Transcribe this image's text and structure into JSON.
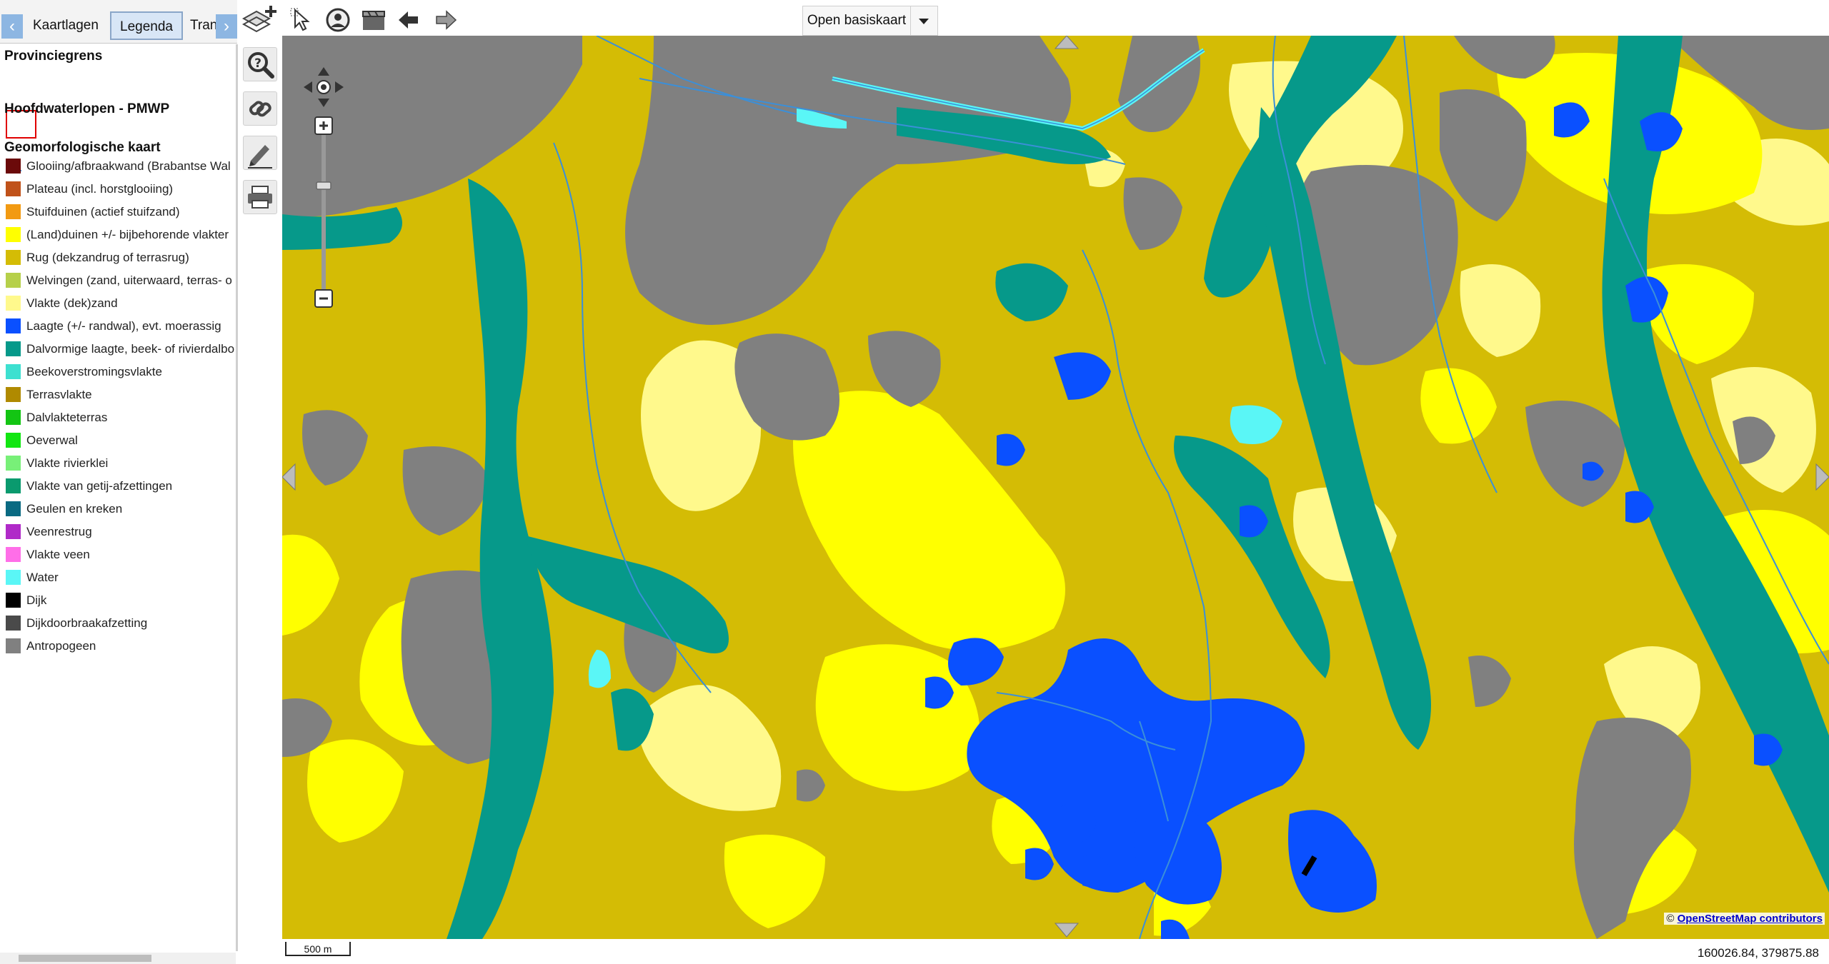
{
  "tabs": {
    "items": [
      "Kaartlagen",
      "Legenda",
      "Tran"
    ],
    "active": "Legenda"
  },
  "legend": {
    "provincie_title": "Provinciegrens",
    "water_title": "Hoofdwaterlopen - PMWP",
    "geo_title": "Geomorfologische kaart",
    "items": [
      {
        "label": "Glooiing/afbraakwand (Brabantse Wal",
        "color": "#6b0a0a"
      },
      {
        "label": "Plateau (incl. horstglooiing)",
        "color": "#c0521a"
      },
      {
        "label": "Stuifduinen (actief stuifzand)",
        "color": "#f29a12"
      },
      {
        "label": "(Land)duinen +/- bijbehorende vlakter",
        "color": "#ffff00"
      },
      {
        "label": "Rug (dekzandrug of terrasrug)",
        "color": "#d4bc05"
      },
      {
        "label": "Welvingen (zand, uiterwaard, terras- o",
        "color": "#b6d04a"
      },
      {
        "label": "Vlakte (dek)zand",
        "color": "#fff98c"
      },
      {
        "label": "Laagte (+/- randwal), evt. moerassig",
        "color": "#0a50ff"
      },
      {
        "label": "Dalvormige laagte, beek- of rivierdalbo",
        "color": "#06998a"
      },
      {
        "label": "Beekoverstromingsvlakte",
        "color": "#3de0d0"
      },
      {
        "label": "Terrasvlakte",
        "color": "#b08a00"
      },
      {
        "label": "Dalvlakteterras",
        "color": "#13c513"
      },
      {
        "label": "Oeverwal",
        "color": "#12e612"
      },
      {
        "label": "Vlakte rivierklei",
        "color": "#78f078"
      },
      {
        "label": "Vlakte van getij-afzettingen",
        "color": "#0a9a6e"
      },
      {
        "label": "Geulen en kreken",
        "color": "#0a6a82"
      },
      {
        "label": "Veenrestrug",
        "color": "#b02ac8"
      },
      {
        "label": "Vlakte veen",
        "color": "#ff6ee8"
      },
      {
        "label": "Water",
        "color": "#5af6f6"
      },
      {
        "label": "Dijk",
        "color": "#000000"
      },
      {
        "label": "Dijkdoorbraakafzetting",
        "color": "#4a4a4a"
      },
      {
        "label": "Antropogeen",
        "color": "#808080"
      }
    ]
  },
  "toolbar": {
    "basemap_label": "Open basiskaart"
  },
  "map": {
    "attribution_prefix": "©",
    "attribution_link": "OpenStreetMap contributors",
    "scale_label": "500 m",
    "coordinates": "160026.84, 379875.88"
  },
  "colors": {
    "rug": "#d4bc05",
    "duinen": "#ffff00",
    "vlakte_dekzand": "#fff98c",
    "laagte": "#0a50ff",
    "dal": "#06998a",
    "antropogeen": "#808080",
    "water": "#5af6f6",
    "waterloop": "#3b8fd8"
  }
}
